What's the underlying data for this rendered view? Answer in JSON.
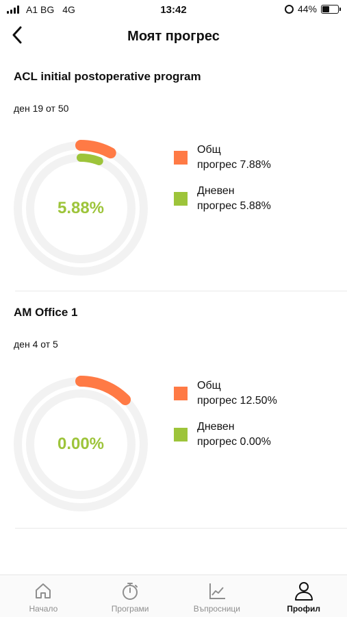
{
  "status_bar": {
    "carrier": "A1 BG",
    "network": "4G",
    "time": "13:42",
    "battery_percent": "44%",
    "battery_level": 0.44
  },
  "header": {
    "title": "Моят прогрес"
  },
  "colors": {
    "overall": "#ff7a45",
    "daily": "#9dc43a",
    "track": "#f2f2f2"
  },
  "programs": [
    {
      "name": "ACL initial postoperative program",
      "day_text": "ден 19 от 50",
      "center_value": "5.88%",
      "overall_progress": 0.0788,
      "daily_progress": 0.0588,
      "legend": [
        {
          "line1": "Общ",
          "line2": "прогрес 7.88%"
        },
        {
          "line1": "Дневен",
          "line2": "прогрес 5.88%"
        }
      ]
    },
    {
      "name": "AM Office 1",
      "day_text": "ден 4 от 5",
      "center_value": "0.00%",
      "overall_progress": 0.125,
      "daily_progress": 0.0,
      "legend": [
        {
          "line1": "Общ",
          "line2": "прогрес 12.50%"
        },
        {
          "line1": "Дневен",
          "line2": "прогрес 0.00%"
        }
      ]
    }
  ],
  "nav": [
    {
      "label": "Начало",
      "icon": "home-icon"
    },
    {
      "label": "Програми",
      "icon": "stopwatch-icon"
    },
    {
      "label": "Въпросници",
      "icon": "chart-icon"
    },
    {
      "label": "Профил",
      "icon": "profile-icon"
    }
  ]
}
